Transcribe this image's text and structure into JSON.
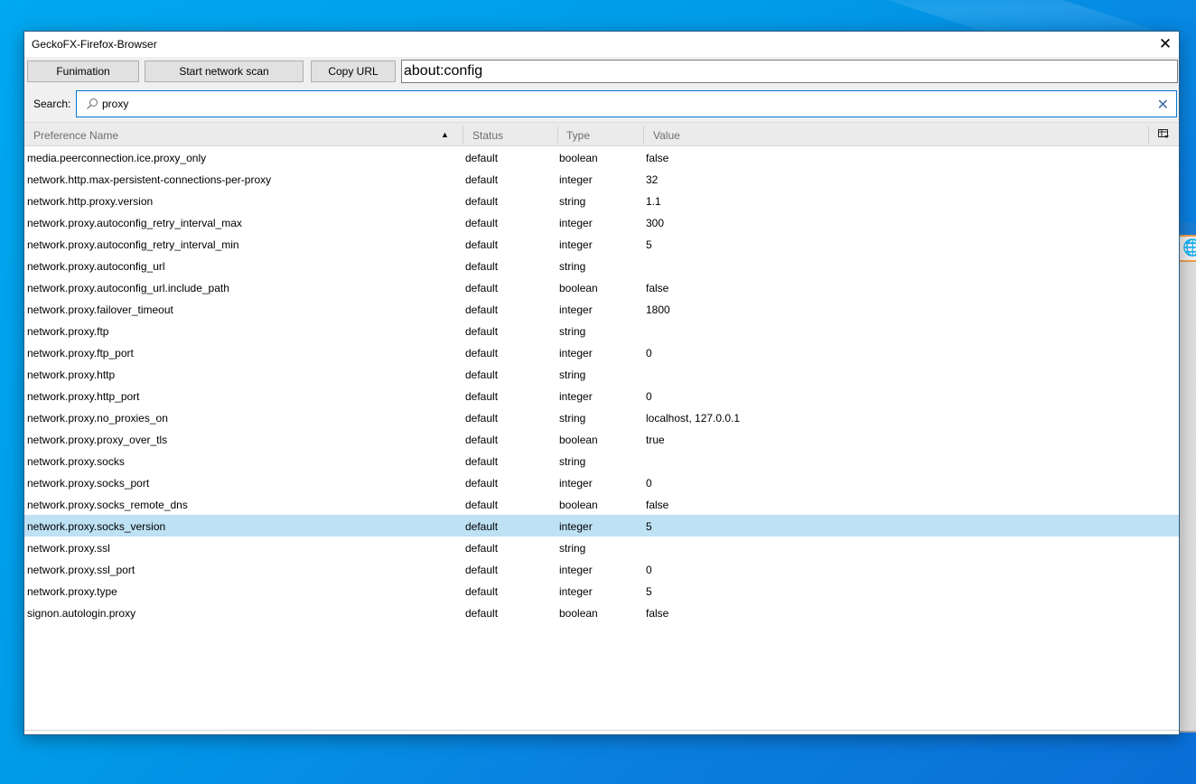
{
  "window": {
    "title": "GeckoFX-Firefox-Browser",
    "close_icon": "close-icon"
  },
  "toolbar": {
    "buttons": [
      {
        "label": "Funimation"
      },
      {
        "label": "Start network scan"
      },
      {
        "label": "Copy URL"
      }
    ],
    "url_value": "about:config"
  },
  "search": {
    "label": "Search:",
    "value": "proxy",
    "search_icon": "magnifier-icon",
    "clear_icon": "clear-icon"
  },
  "table": {
    "columns": [
      {
        "label": "Preference Name",
        "sorted": "ascending"
      },
      {
        "label": "Status"
      },
      {
        "label": "Type"
      },
      {
        "label": "Value"
      }
    ],
    "column_picker_icon": "column-picker-icon",
    "rows": [
      {
        "name": "media.peerconnection.ice.proxy_only",
        "status": "default",
        "type": "boolean",
        "value": "false"
      },
      {
        "name": "network.http.max-persistent-connections-per-proxy",
        "status": "default",
        "type": "integer",
        "value": "32"
      },
      {
        "name": "network.http.proxy.version",
        "status": "default",
        "type": "string",
        "value": "1.1"
      },
      {
        "name": "network.proxy.autoconfig_retry_interval_max",
        "status": "default",
        "type": "integer",
        "value": "300"
      },
      {
        "name": "network.proxy.autoconfig_retry_interval_min",
        "status": "default",
        "type": "integer",
        "value": "5"
      },
      {
        "name": "network.proxy.autoconfig_url",
        "status": "default",
        "type": "string",
        "value": ""
      },
      {
        "name": "network.proxy.autoconfig_url.include_path",
        "status": "default",
        "type": "boolean",
        "value": "false"
      },
      {
        "name": "network.proxy.failover_timeout",
        "status": "default",
        "type": "integer",
        "value": "1800"
      },
      {
        "name": "network.proxy.ftp",
        "status": "default",
        "type": "string",
        "value": ""
      },
      {
        "name": "network.proxy.ftp_port",
        "status": "default",
        "type": "integer",
        "value": "0"
      },
      {
        "name": "network.proxy.http",
        "status": "default",
        "type": "string",
        "value": ""
      },
      {
        "name": "network.proxy.http_port",
        "status": "default",
        "type": "integer",
        "value": "0"
      },
      {
        "name": "network.proxy.no_proxies_on",
        "status": "default",
        "type": "string",
        "value": "localhost, 127.0.0.1"
      },
      {
        "name": "network.proxy.proxy_over_tls",
        "status": "default",
        "type": "boolean",
        "value": "true"
      },
      {
        "name": "network.proxy.socks",
        "status": "default",
        "type": "string",
        "value": ""
      },
      {
        "name": "network.proxy.socks_port",
        "status": "default",
        "type": "integer",
        "value": "0"
      },
      {
        "name": "network.proxy.socks_remote_dns",
        "status": "default",
        "type": "boolean",
        "value": "false"
      },
      {
        "name": "network.proxy.socks_version",
        "status": "default",
        "type": "integer",
        "value": "5",
        "selected": true
      },
      {
        "name": "network.proxy.ssl",
        "status": "default",
        "type": "string",
        "value": ""
      },
      {
        "name": "network.proxy.ssl_port",
        "status": "default",
        "type": "integer",
        "value": "0"
      },
      {
        "name": "network.proxy.type",
        "status": "default",
        "type": "integer",
        "value": "5"
      },
      {
        "name": "signon.autologin.proxy",
        "status": "default",
        "type": "boolean",
        "value": "false"
      }
    ]
  },
  "colors": {
    "selection": "#bee1f4",
    "focus_border": "#0078d7",
    "desktop": "#0095e6"
  }
}
